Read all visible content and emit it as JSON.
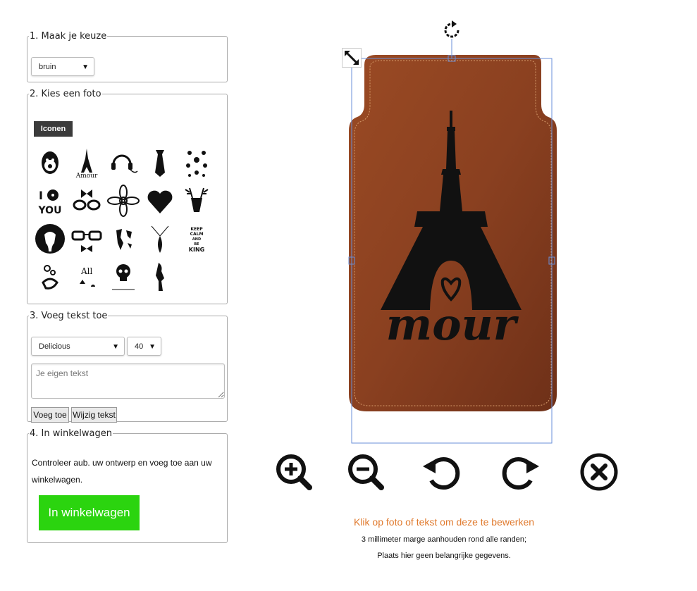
{
  "step1": {
    "legend": "1. Maak je keuze",
    "select_value": "bruin"
  },
  "step2": {
    "legend": "2. Kies een foto",
    "tab_label": "Iconen",
    "icons": [
      "monkey-icon",
      "eiffel-amour-icon",
      "headphones-icon",
      "necktie-icon",
      "mustache-pattern-icon",
      "i-love-you-icon",
      "bow-glasses-icon",
      "flower-icon",
      "heart-icon",
      "deer-icon",
      "elephant-icon",
      "glasses-bowtie-icon",
      "world-map-icon",
      "feather-necklace-icon",
      "keep-calm-king-icon",
      "horn-flowers-icon",
      "cards-icon",
      "skull-icon",
      "woman-silhouette-icon"
    ]
  },
  "step3": {
    "legend": "3. Voeg tekst toe",
    "font_value": "Delicious",
    "size_value": "40",
    "text_placeholder": "Je eigen tekst",
    "add_label": "Voeg toe",
    "edit_label": "Wijzig tekst"
  },
  "step4": {
    "legend": "4. In winkelwagen",
    "instruction": "Controleer aub. uw ontwerp en voeg toe aan uw winkelwagen.",
    "cart_label": "In winkelwagen"
  },
  "canvas": {
    "design_text": "mour",
    "colors": {
      "leather": "#8a4020",
      "cart_green": "#2bd40f",
      "hint_orange": "#e07a2e"
    }
  },
  "toolbar": [
    "zoom-in-icon",
    "zoom-out-icon",
    "rotate-left-icon",
    "rotate-right-icon",
    "delete-icon"
  ],
  "notes": {
    "hint": "Klik op foto of tekst om deze te bewerken",
    "margin": "3 millimeter marge aanhouden rond alle randen;",
    "info": "Plaats hier geen belangrijke gegevens."
  }
}
